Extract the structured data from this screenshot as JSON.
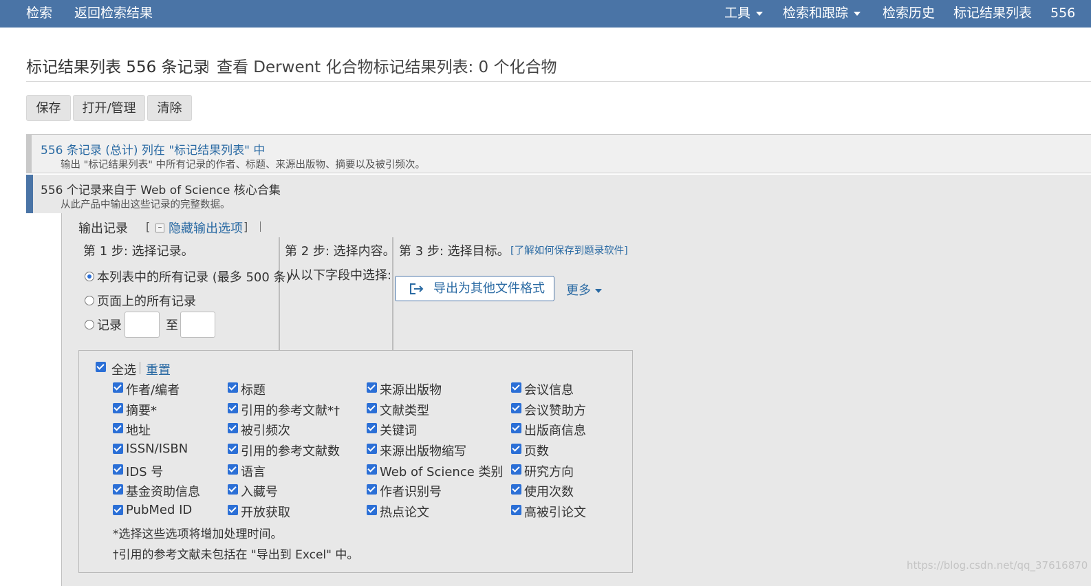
{
  "topbar": {
    "search": "检索",
    "back": "返回检索结果",
    "tools": "工具",
    "search_track": "检索和跟踪",
    "history": "检索历史",
    "marked_list": "标记结果列表",
    "marked_count": "556"
  },
  "header": {
    "title": "标记结果列表 556 条记录",
    "derwent_link": "查看 Derwent 化合物标记结果列表: 0 个化合物"
  },
  "toolbar": {
    "save": "保存",
    "open_manage": "打开/管理",
    "clear": "清除"
  },
  "section_total": {
    "title": "556 条记录 (总计) 列在 \"标记结果列表\" 中",
    "desc": "输出 \"标记结果列表\" 中所有记录的作者、标题、来源出版物、摘要以及被引频次。"
  },
  "section_wos": {
    "title": "556 个记录来自于 Web of Science 核心合集",
    "desc": "从此产品中输出这些记录的完整数据。"
  },
  "output": {
    "label": "输出记录",
    "bracket_open": "[",
    "minus": "–",
    "hide_link": "隐藏输出选项",
    "bracket_close": "]"
  },
  "step1": {
    "title": "第 1 步: 选择记录。",
    "opt_all": "本列表中的所有记录 (最多 500 条)",
    "opt_page": "页面上的所有记录",
    "opt_range": "记录",
    "to": "至"
  },
  "step2": {
    "title": "第 2 步: 选择内容。",
    "hint": "从以下字段中选择:"
  },
  "step3": {
    "title": "第 3 步: 选择目标。",
    "learn": "[了解如何保存到题录软件]",
    "export_button": "导出为其他文件格式",
    "more": "更多"
  },
  "fields": {
    "select_all": "全选",
    "reset": "重置",
    "columns": [
      [
        "作者/编者",
        "摘要*",
        "地址",
        "ISSN/ISBN",
        "IDS 号",
        "基金资助信息",
        "PubMed ID"
      ],
      [
        "标题",
        "引用的参考文献*†",
        "被引频次",
        "引用的参考文献数",
        "语言",
        "入藏号",
        "开放获取"
      ],
      [
        "来源出版物",
        "文献类型",
        "关键词",
        "来源出版物缩写",
        "Web of Science 类别",
        "作者识别号",
        "热点论文"
      ],
      [
        "会议信息",
        "会议赞助方",
        "出版商信息",
        "页数",
        "研究方向",
        "使用次数",
        "高被引论文"
      ]
    ],
    "note1": "*选择这些选项将增加处理时间。",
    "note2": "†引用的参考文献未包括在 \"导出到 Excel\" 中。"
  },
  "watermark": "https://blog.csdn.net/qq_37616870",
  "colors": {
    "topbar": "#4a74a6",
    "link": "#2a6aa3",
    "checkbox": "#2b6fd6"
  }
}
